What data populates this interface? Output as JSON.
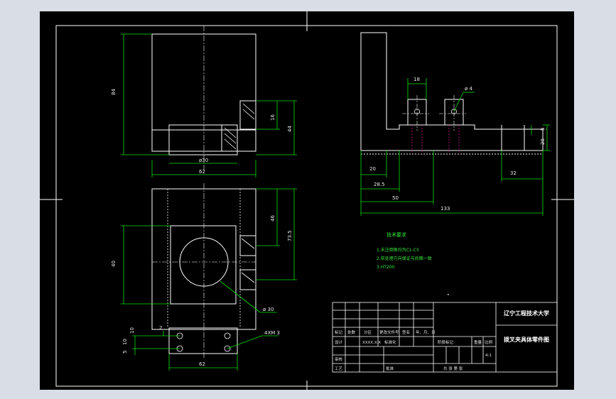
{
  "viewer": {
    "background": "#d8dde6",
    "sheet_color": "#000000",
    "line_color": "#ffffff",
    "dim_color": "#00e000",
    "hidden_color": "#c8108c"
  },
  "front_view": {
    "dim_height": "84",
    "dim_bore": "ø30",
    "dim_width": "62",
    "dim_slot_height": "16",
    "dim_slot_total": "44"
  },
  "top_view": {
    "dim_left": "40",
    "dim_right_1": "46",
    "dim_right_2": "73.5",
    "dim_bottom_width": "62",
    "dim_small_1": "2",
    "dim_small_2": "10",
    "dim_small_3": "5",
    "dim_small_4": "10",
    "callout_bore": "ø 30",
    "callout_holes": "4XM 3"
  },
  "side_view": {
    "dim_top": "18",
    "callout_hole": "ø 4",
    "dim_20": "20",
    "dim_28_5": "28.5",
    "dim_50": "50",
    "dim_133": "133",
    "dim_32": "32",
    "dim_right_20": "20",
    "dim_right_5": "5"
  },
  "tech_requirements": {
    "title": "技术要求",
    "items": [
      "1.未注倒角均为C1-C5",
      "2.前处理方向保证与后面一致",
      "3.HT200"
    ]
  },
  "title_block": {
    "school": "辽宁工程技术大学",
    "drawing_name": "拨叉夹具体零件图",
    "row_headers": [
      "标记",
      "处数",
      "分区",
      "更改文件号",
      "签名",
      "年、月、日"
    ],
    "row_labels": [
      "设计",
      "标准化",
      "审核",
      "工艺",
      "批准"
    ],
    "row_values": [
      "XXXX.X.X",
      ""
    ],
    "stage_label": "阶段标记",
    "weight_label": "重量",
    "scale_label": "比例",
    "scale_value": "4:1",
    "sheet_label": "共 张 第 张"
  }
}
